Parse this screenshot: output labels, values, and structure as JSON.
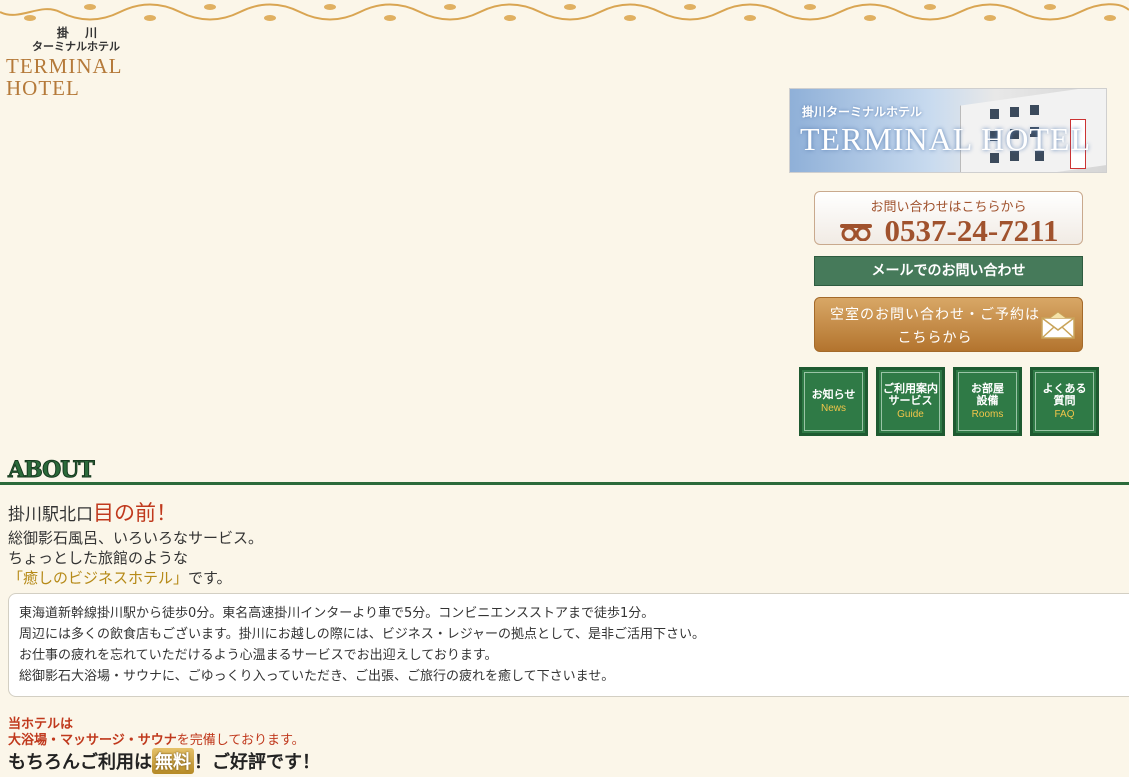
{
  "logo": {
    "line1": "掛 川",
    "line2": "ターミナルホテル",
    "en": "TERMINAL HOTEL"
  },
  "banner": {
    "small": "掛川ターミナルホテル",
    "large": "TERMINAL HOTEL"
  },
  "contact": {
    "phone_label": "お問い合わせはこちらから",
    "phone_number": "0537-24-7211",
    "mail_button": "メールでのお問い合わせ",
    "reserve_line1": "空室のお問い合わせ・ご予約は",
    "reserve_line2": "こちらから"
  },
  "nav": [
    {
      "jp": "お知らせ",
      "en": "News"
    },
    {
      "jp": "ご利用案内\nサービス",
      "en": "Guide"
    },
    {
      "jp": "お部屋\n設備",
      "en": "Rooms"
    },
    {
      "jp": "よくある\n質問",
      "en": "FAQ"
    }
  ],
  "about": {
    "title": "ABOUT",
    "lead_a": "掛川駅北口",
    "lead_b": "目の前！",
    "line2": "総御影石風呂、いろいろなサービス。",
    "line3": "ちょっとした旅館のような",
    "line4_a": "「癒しのビジネスホテル」",
    "line4_b": "です。",
    "body": [
      "東海道新幹線掛川駅から徒歩0分。東名高速掛川インターより車で5分。コンビニエンスストアまで徒歩1分。",
      "周辺には多くの飲食店もございます。掛川にお越しの際には、ビジネス・レジャーの拠点として、是非ご活用下さい。",
      "お仕事の疲れを忘れていただけるよう心温まるサービスでお出迎えしております。",
      "総御影石大浴場・サウナに、ごゆっくり入っていただき、ご出張、ご旅行の疲れを癒して下さいませ。"
    ]
  },
  "feature": {
    "line1": "当ホテルは",
    "line2_a": "大浴場・マッサージ・サウナ",
    "line2_b": "を完備しております。",
    "line3_a": "もちろんご利用は",
    "line3_free": "無料",
    "line3_b": "！ご好評です！"
  },
  "colors": {
    "background": "#fbf6e9",
    "green": "#2f7a46",
    "accent_red": "#c0391d",
    "brown": "#a0522d"
  }
}
